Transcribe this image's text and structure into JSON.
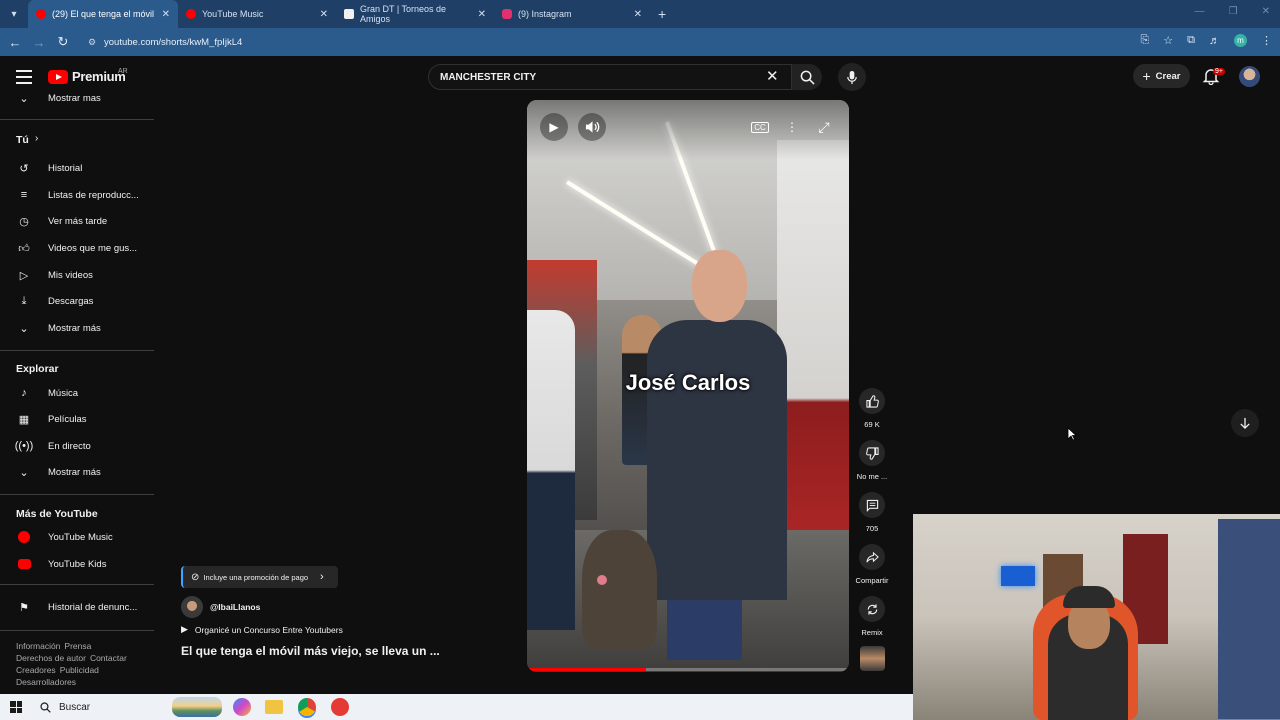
{
  "browser": {
    "tabs": [
      {
        "title": "(29) El que tenga el móvil más v",
        "active": true,
        "icon_color": "#ff0000"
      },
      {
        "title": "YouTube Music",
        "active": false,
        "icon_color": "#ff0000"
      },
      {
        "title": "Gran DT | Torneos de Amigos",
        "active": false,
        "icon_color": "#f1f1f1"
      },
      {
        "title": "(9) Instagram",
        "active": false,
        "icon_color": "#e1306c"
      }
    ],
    "url": "youtube.com/shorts/kwM_fpIjkL4",
    "profile_initial": "m"
  },
  "masthead": {
    "logo_text": "Premium",
    "country_code": "AR",
    "search_value": "MANCHESTER CITY",
    "create_label": "Crear",
    "notifications_badge": "9+"
  },
  "sidebar": {
    "top_more": "Mostrar mas",
    "you_heading": "Tú",
    "you_items": [
      {
        "label": "Historial",
        "icon": "history-icon"
      },
      {
        "label": "Listas de reproducc...",
        "icon": "playlists-icon"
      },
      {
        "label": "Ver más tarde",
        "icon": "watch-later-icon"
      },
      {
        "label": "Videos que me gus...",
        "icon": "liked-videos-icon"
      },
      {
        "label": "Mis videos",
        "icon": "my-videos-icon"
      },
      {
        "label": "Descargas",
        "icon": "downloads-icon"
      },
      {
        "label": "Mostrar más",
        "icon": "chevron-down-icon"
      }
    ],
    "explore_heading": "Explorar",
    "explore_items": [
      {
        "label": "Música",
        "icon": "music-icon"
      },
      {
        "label": "Películas",
        "icon": "movies-icon"
      },
      {
        "label": "En directo",
        "icon": "live-icon"
      },
      {
        "label": "Mostrar más",
        "icon": "chevron-down-icon"
      }
    ],
    "more_heading": "Más de YouTube",
    "more_items": [
      {
        "label": "YouTube Music",
        "icon": "youtube-music-icon"
      },
      {
        "label": "YouTube Kids",
        "icon": "youtube-kids-icon"
      }
    ],
    "report_item": "Historial de denunc...",
    "footer_line1": [
      "Información",
      "Prensa"
    ],
    "footer_line2": [
      "Derechos de autor",
      "Contactar"
    ],
    "footer_line3": [
      "Creadores",
      "Publicidad"
    ],
    "footer_line4": [
      "Desarrolladores"
    ]
  },
  "short": {
    "caption": "José Carlos",
    "promo_label": "Incluye una promoción de pago",
    "channel": "@IbaiLlanos",
    "playlist_label": "Organicé un Concurso Entre Youtubers",
    "title": "El que tenga el móvil más viejo, se lleva un ...",
    "progress": 0.37,
    "actions": {
      "likes": "69 K",
      "dislike": "No me ...",
      "comments": "705",
      "share": "Compartir",
      "remix": "Remix"
    }
  },
  "taskbar": {
    "search_placeholder": "Buscar"
  }
}
